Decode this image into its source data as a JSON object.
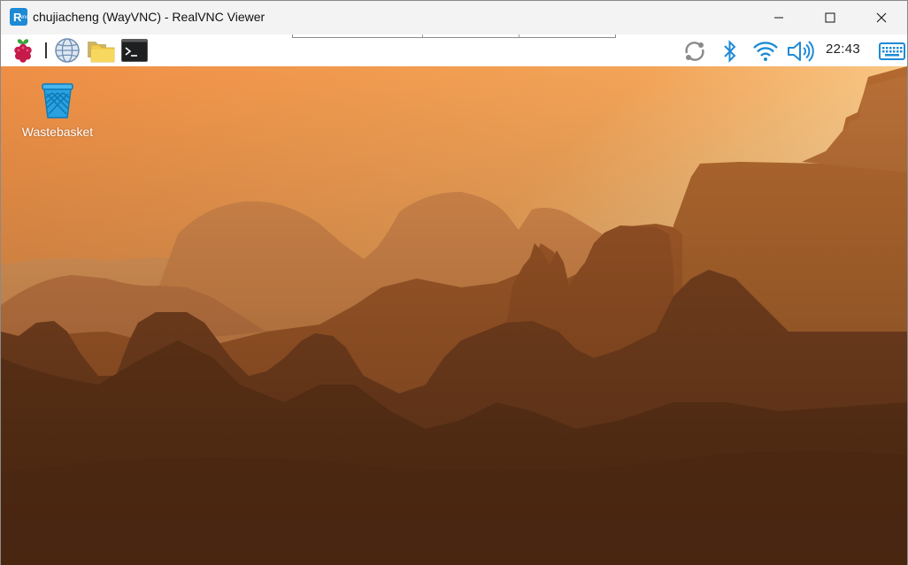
{
  "window": {
    "title": "chujiacheng (WayVNC) - RealVNC Viewer",
    "app_icon": "realvnc-icon",
    "controls": {
      "minimize": "minimize-icon",
      "maximize": "maximize-icon",
      "close": "close-icon"
    }
  },
  "panel": {
    "launchers": [
      {
        "name": "raspberry-menu-icon"
      },
      {
        "name": "web-browser-icon"
      },
      {
        "name": "file-manager-icon"
      },
      {
        "name": "terminal-icon"
      }
    ],
    "tray": [
      {
        "name": "updater-icon"
      },
      {
        "name": "bluetooth-icon"
      },
      {
        "name": "wifi-icon"
      },
      {
        "name": "volume-icon"
      }
    ],
    "clock": "22:43",
    "keyboard": "virtual-keyboard-icon",
    "accent_color": "#1e8ad6"
  },
  "desktop": {
    "icons": [
      {
        "label": "Wastebasket",
        "icon": "wastebasket-icon"
      }
    ],
    "wallpaper": "desert mountains at sunset"
  }
}
